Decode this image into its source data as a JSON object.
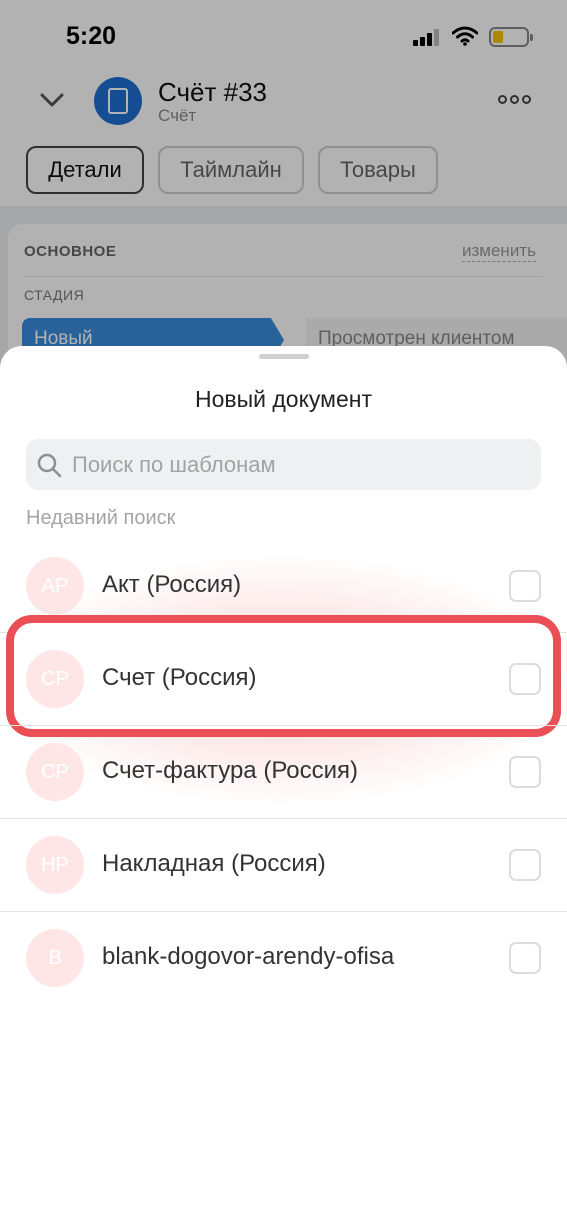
{
  "status_bar": {
    "time": "5:20"
  },
  "header": {
    "title": "Счёт #33",
    "subtitle": "Счёт"
  },
  "tabs": [
    {
      "label": "Детали",
      "active": true
    },
    {
      "label": "Таймлайн",
      "active": false
    },
    {
      "label": "Товары",
      "active": false
    }
  ],
  "card": {
    "section_title": "ОСНОВНОЕ",
    "edit_label": "изменить",
    "stage_label": "СТАДИЯ",
    "stage_current": "Новый",
    "stage_next": "Просмотрен клиентом"
  },
  "sheet": {
    "title": "Новый документ",
    "search_placeholder": "Поиск по шаблонам",
    "recent_label": "Недавний поиск",
    "items": [
      {
        "initials": "AP",
        "label": "Акт (Россия)",
        "checked": false
      },
      {
        "initials": "CP",
        "label": "Счет (Россия)",
        "checked": false,
        "highlighted": true
      },
      {
        "initials": "CP",
        "label": "Счет-фактура (Россия)",
        "checked": false
      },
      {
        "initials": "HP",
        "label": "Накладная (Россия)",
        "checked": false
      },
      {
        "initials": "B",
        "label": "blank-dogovor-arendy-ofisa",
        "checked": false
      }
    ]
  },
  "colors": {
    "accent": "#3b8dde",
    "highlight": "#e94f55",
    "avatar_bg": "#ffe6e6",
    "doc_avatar": "#1f6fd1"
  }
}
